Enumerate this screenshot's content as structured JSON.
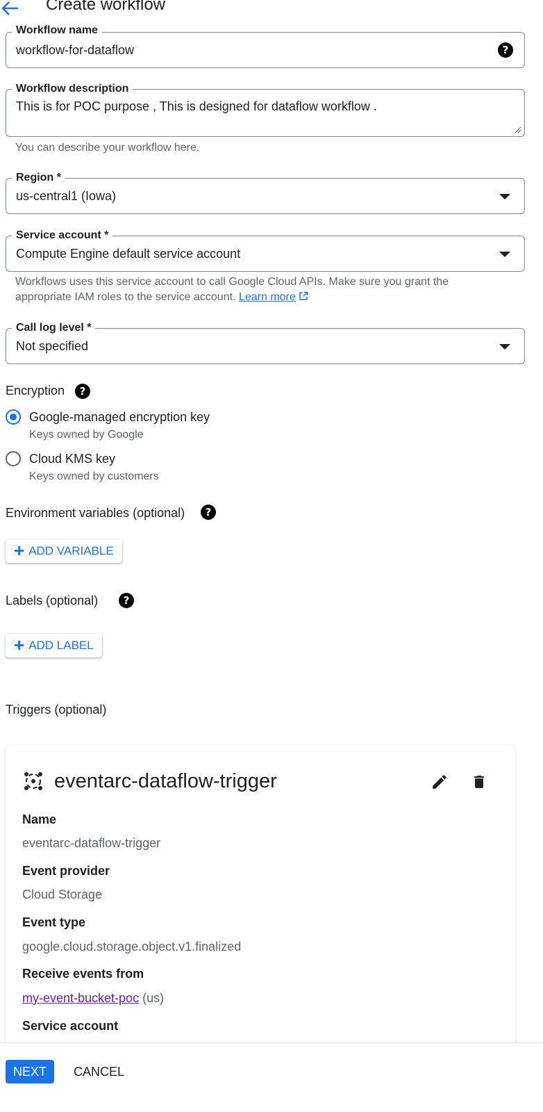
{
  "header": {
    "title": "Create workflow",
    "back_icon": "arrow-back-icon"
  },
  "form": {
    "workflow_name": {
      "label": "Workflow name",
      "value": "workflow-for-dataflow"
    },
    "workflow_description": {
      "label": "Workflow description",
      "value": "This is for POC purpose , This is designed for dataflow workflow .",
      "hint": "You can describe your workflow here."
    },
    "region": {
      "label": "Region *",
      "value": "us-central1 (Iowa)"
    },
    "service_account": {
      "label": "Service account *",
      "value": "Compute Engine default service account",
      "hint_line1": "Workflows uses this service account to call Google Cloud APIs. Make sure you grant the",
      "hint_line2": "appropriate IAM roles to the service account.",
      "learn_more": "Learn more"
    },
    "call_log_level": {
      "label": "Call log level *",
      "value": "Not specified"
    }
  },
  "encryption": {
    "heading": "Encryption",
    "options": [
      {
        "label": "Google-managed encryption key",
        "sub": "Keys owned by Google",
        "selected": true
      },
      {
        "label": "Cloud KMS key",
        "sub": "Keys owned by customers",
        "selected": false
      }
    ]
  },
  "env_vars": {
    "heading": "Environment variables (optional)",
    "button": "ADD VARIABLE"
  },
  "labels": {
    "heading": "Labels (optional)",
    "button": "ADD LABEL"
  },
  "triggers": {
    "heading": "Triggers (optional)",
    "card": {
      "title": "eventarc-dataflow-trigger",
      "fields": [
        {
          "label": "Name",
          "value": "eventarc-dataflow-trigger"
        },
        {
          "label": "Event provider",
          "value": "Cloud Storage"
        },
        {
          "label": "Event type",
          "value": "google.cloud.storage.object.v1.finalized"
        },
        {
          "label": "Receive events from",
          "link": "my-event-bucket-poc",
          "suffix": " (us)"
        },
        {
          "label": "Service account"
        }
      ]
    }
  },
  "footer": {
    "next": "NEXT",
    "cancel": "CANCEL"
  },
  "colors": {
    "accent": "#1a73e8",
    "visited_link": "#681da8",
    "text": "#202124",
    "muted": "#5f6368",
    "border": "#80868b"
  }
}
